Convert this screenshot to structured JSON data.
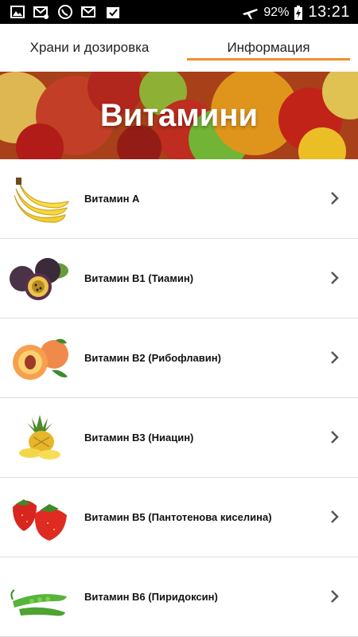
{
  "status_bar": {
    "battery_percent": "92%",
    "time": "13:21",
    "icons": [
      "gallery-icon",
      "missed-email-icon",
      "viber-icon",
      "email-icon",
      "task-check-icon",
      "airplane-mode-icon",
      "battery-charging-icon"
    ]
  },
  "tabs": [
    {
      "label": "Храни и дозировка",
      "active": false
    },
    {
      "label": "Информация",
      "active": true
    }
  ],
  "colors": {
    "accent": "#f28e2b",
    "divider": "#dedede"
  },
  "banner": {
    "title": "Витамини"
  },
  "items": [
    {
      "label": "Витамин А",
      "icon": "banana-icon"
    },
    {
      "label": "Витамин B1 (Тиамин)",
      "icon": "passion-fruit-icon"
    },
    {
      "label": "Витамин B2 (Рибофлавин)",
      "icon": "peach-icon"
    },
    {
      "label": "Витамин B3 (Ниацин)",
      "icon": "pineapple-icon"
    },
    {
      "label": "Витамин B5 (Пантотенова киселина)",
      "icon": "strawberry-icon"
    },
    {
      "label": "Витамин B6 (Пиридоксин)",
      "icon": "pea-pod-icon"
    }
  ]
}
